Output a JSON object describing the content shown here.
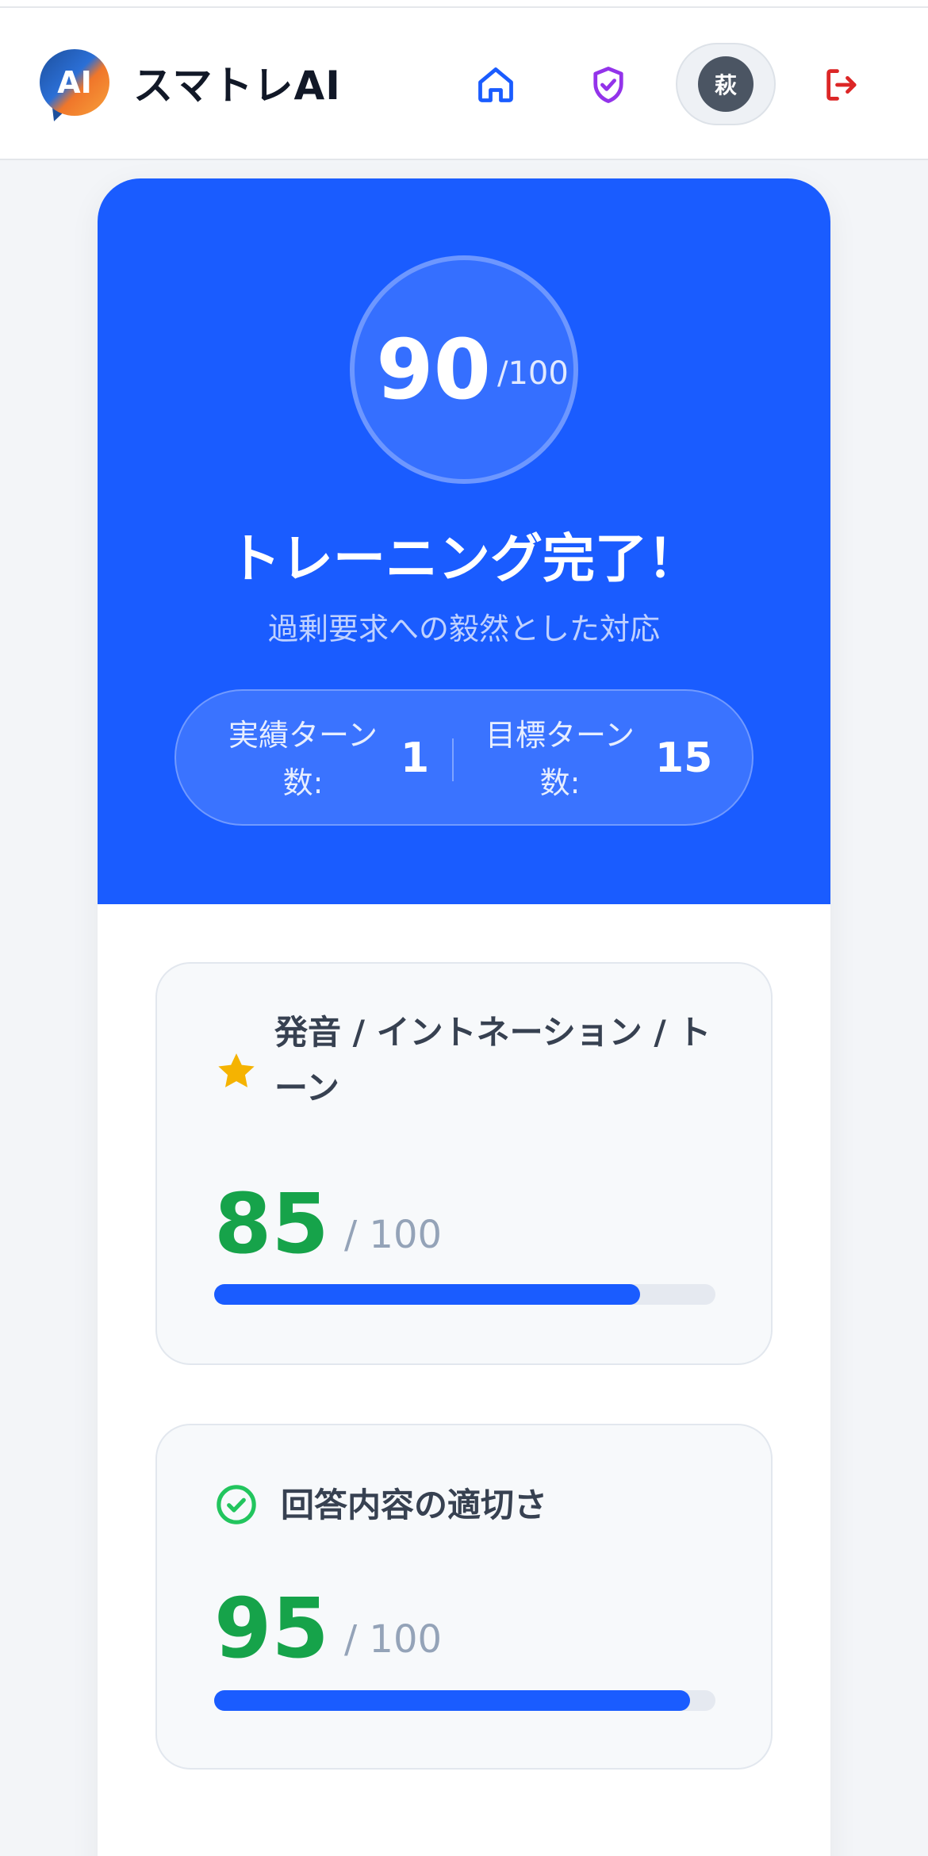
{
  "header": {
    "logo_text": "AI",
    "brand": "スマトレAI",
    "avatar_initial": "萩",
    "nav_icons": [
      "home-icon",
      "shield-check-icon",
      "logout-icon"
    ]
  },
  "summary": {
    "score": "90",
    "score_max": "/100",
    "title": "トレーニング完了！",
    "scenario": "過剰要求への毅然とした対応",
    "actual_turns_label": "実績ターン数:",
    "actual_turns_value": "1",
    "target_turns_label": "目標ターン数:",
    "target_turns_value": "15"
  },
  "metrics": [
    {
      "icon": "star-icon",
      "title": "発音 / イントネーション / トーン",
      "score": "85",
      "max": "/ 100",
      "progress": 0.85
    },
    {
      "icon": "check-circle-icon",
      "title": "回答内容の適切さ",
      "score": "95",
      "max": "/ 100",
      "progress": 0.95
    }
  ],
  "colors": {
    "accent": "#1a5cff",
    "score_green": "#16a34a",
    "star": "#f5b301",
    "check": "#22c55e",
    "shield": "#9333ea",
    "logout": "#dc2626"
  }
}
